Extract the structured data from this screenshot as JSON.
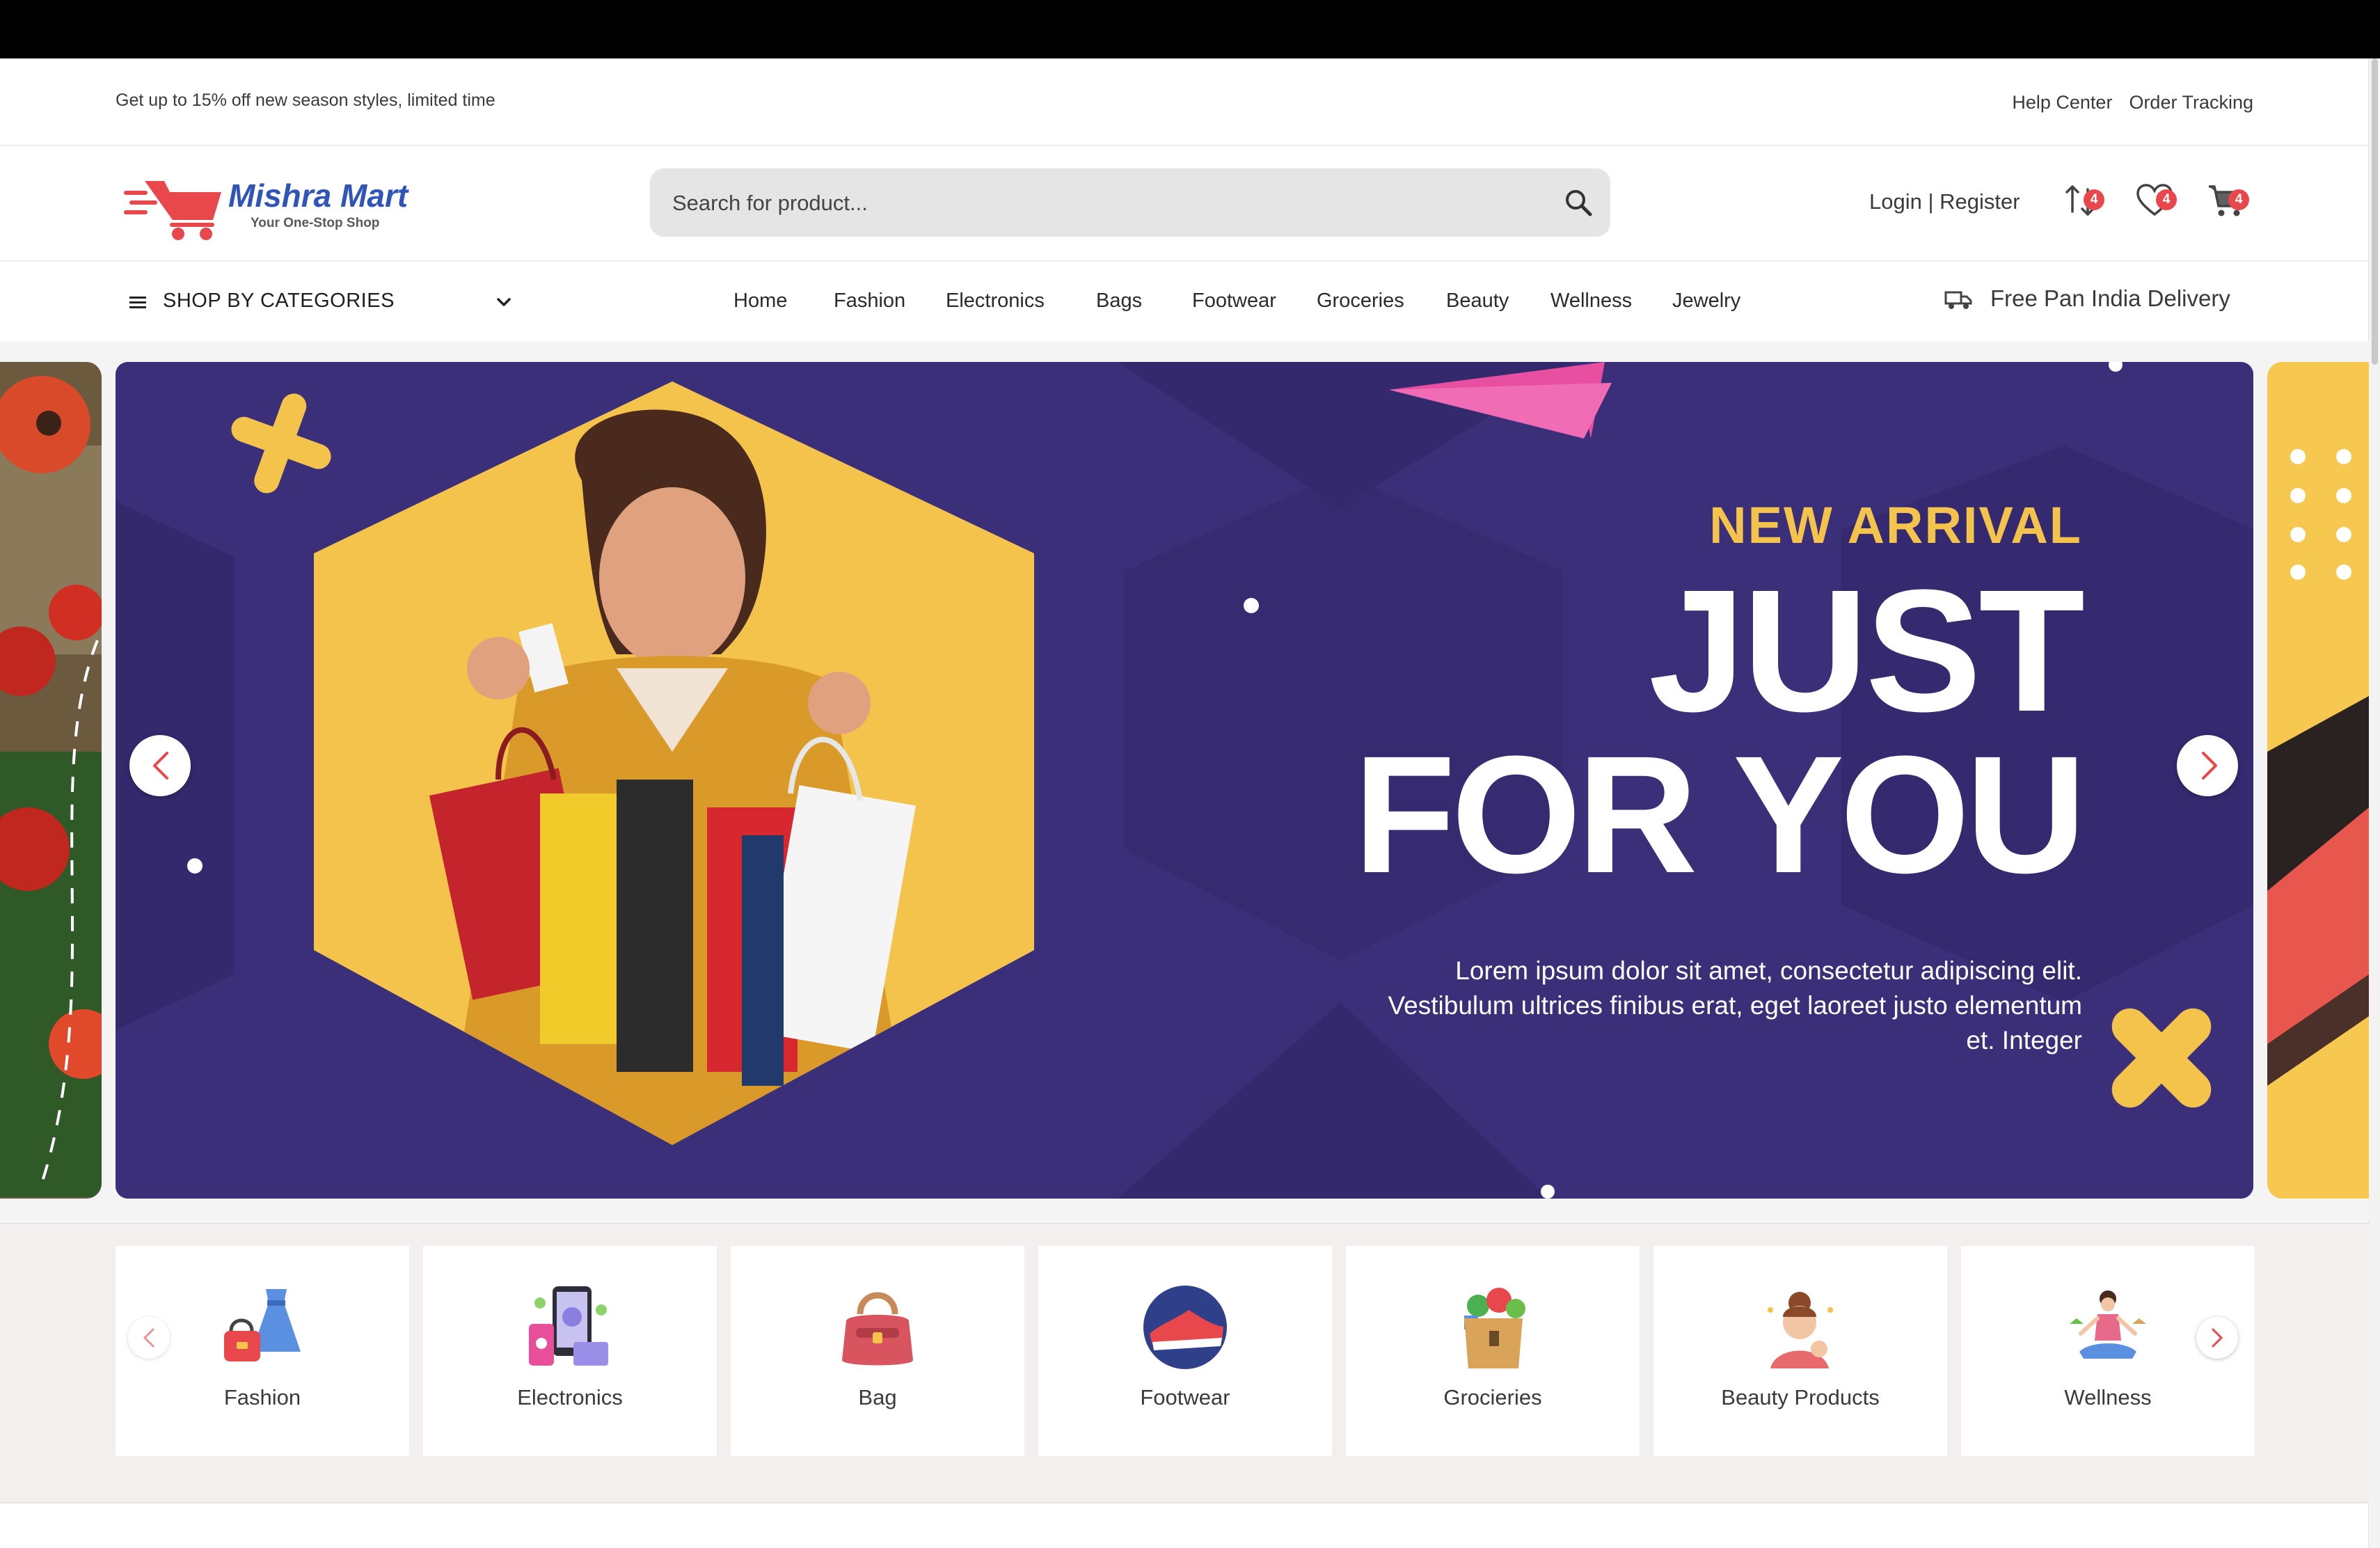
{
  "promo_bar": {
    "message": "Get up to 15% off new season styles, limited time",
    "links": [
      "Help Center",
      "Order Tracking"
    ]
  },
  "header": {
    "logo": {
      "title": "Mishra Mart",
      "tagline": "Your One-Stop Shop"
    },
    "search": {
      "placeholder": "Search for product...",
      "value": ""
    },
    "login_label": "Login | Register",
    "icons": [
      {
        "name": "compare-icon",
        "badge": "4"
      },
      {
        "name": "heart-icon",
        "badge": "4"
      },
      {
        "name": "cart-icon",
        "badge": "4"
      }
    ]
  },
  "nav": {
    "category_menu_label": "SHOP BY CATEGORIES",
    "links": [
      "Home",
      "Fashion",
      "Electronics",
      "Bags",
      "Footwear",
      "Groceries",
      "Beauty",
      "Wellness",
      "Jewelry"
    ],
    "delivery_label": "Free Pan India Delivery"
  },
  "hero": {
    "kicker": "NEW ARRIVAL",
    "title_line1": "JUST",
    "title_line2": "FOR YOU",
    "body": "Lorem ipsum dolor sit amet, consectetur adipiscing elit. Vestibulum ultrices finibus erat, eget laoreet justo elementum et. Integer",
    "colors": {
      "background": "#3b2f79",
      "accent": "#f4c34c",
      "pink": "#e84fa1"
    }
  },
  "categories": [
    {
      "label": "Fashion",
      "icon": "dress-handbag-icon"
    },
    {
      "label": "Electronics",
      "icon": "devices-icon"
    },
    {
      "label": "Bag",
      "icon": "bag-icon"
    },
    {
      "label": "Footwear",
      "icon": "sneaker-icon"
    },
    {
      "label": "Grocieries",
      "icon": "grocery-bag-icon"
    },
    {
      "label": "Beauty Products",
      "icon": "beauty-icon"
    },
    {
      "label": "Wellness",
      "icon": "yoga-icon"
    }
  ]
}
